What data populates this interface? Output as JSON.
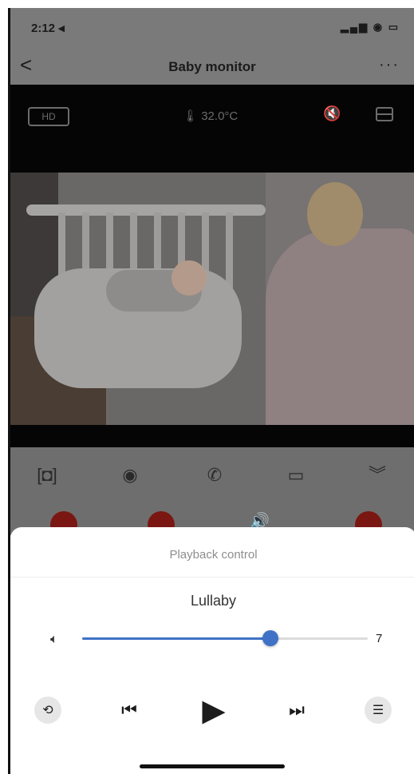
{
  "status_bar": {
    "time": "2:12 ◂",
    "icons": "▂▄▆ ◉ ▭"
  },
  "nav": {
    "title": "Baby monitor",
    "back": "<",
    "more": "···"
  },
  "camera_bar": {
    "quality": "HD",
    "temperature": "32.0°C",
    "temp_icon": "thermometer-icon",
    "mute_icon": "speaker-muted-icon"
  },
  "controls": [
    {
      "icon": "screenshot-frame-icon",
      "glyph": "[◘]"
    },
    {
      "icon": "camera-icon",
      "glyph": "◉"
    },
    {
      "icon": "phone-call-icon",
      "glyph": "✆"
    },
    {
      "icon": "video-record-icon",
      "glyph": "▭"
    },
    {
      "icon": "chevron-double-down-icon",
      "glyph": "︾"
    }
  ],
  "playback": {
    "title": "Playback control",
    "track": "Lullaby",
    "volume_value": "7",
    "volume_fraction": 0.66
  },
  "colors": {
    "accent": "#3f72c7",
    "red_button": "#7a1712"
  }
}
